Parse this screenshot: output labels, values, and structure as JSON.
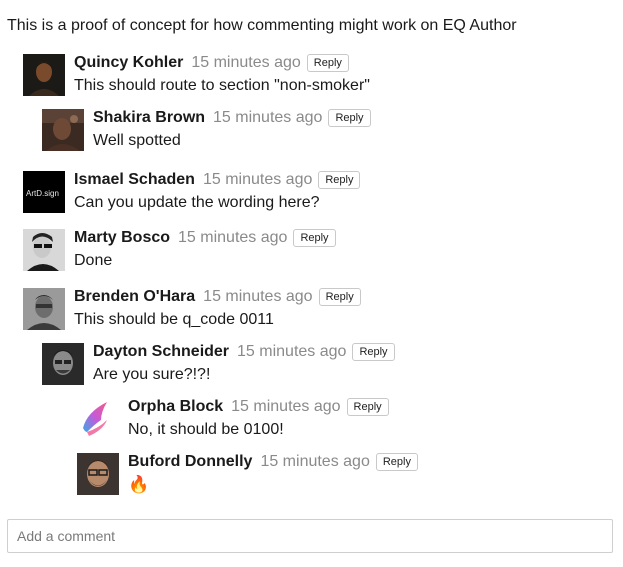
{
  "intro": "This is a proof of concept for how commenting might work on EQ Author",
  "comments": [
    {
      "author": "Quincy Kohler",
      "time": "15 minutes ago",
      "reply": "Reply",
      "text": "This should route to section \"non-smoker\"",
      "avatar": "photo-avatar"
    },
    {
      "author": "Shakira Brown",
      "time": "15 minutes ago",
      "reply": "Reply",
      "text": "Well spotted",
      "avatar": "photo-avatar"
    },
    {
      "author": "Ismael Schaden",
      "time": "15 minutes ago",
      "reply": "Reply",
      "text": "Can you update the wording here?",
      "avatar": "logo-avatar",
      "avatar_text": "ArtD.sign"
    },
    {
      "author": "Marty Bosco",
      "time": "15 minutes ago",
      "reply": "Reply",
      "text": "Done",
      "avatar": "photo-avatar"
    },
    {
      "author": "Brenden O'Hara",
      "time": "15 minutes ago",
      "reply": "Reply",
      "text": "This should be q_code 0011",
      "avatar": "photo-avatar"
    },
    {
      "author": "Dayton Schneider",
      "time": "15 minutes ago",
      "reply": "Reply",
      "text": "Are you sure?!?!",
      "avatar": "photo-avatar"
    },
    {
      "author": "Orpha Block",
      "time": "15 minutes ago",
      "reply": "Reply",
      "text": "No, it should be 0100!",
      "avatar": "feather-logo-avatar"
    },
    {
      "author": "Buford Donnelly",
      "time": "15 minutes ago",
      "reply": "Reply",
      "text": "🔥",
      "avatar": "photo-avatar"
    }
  ],
  "add_comment": {
    "placeholder": "Add a comment"
  }
}
